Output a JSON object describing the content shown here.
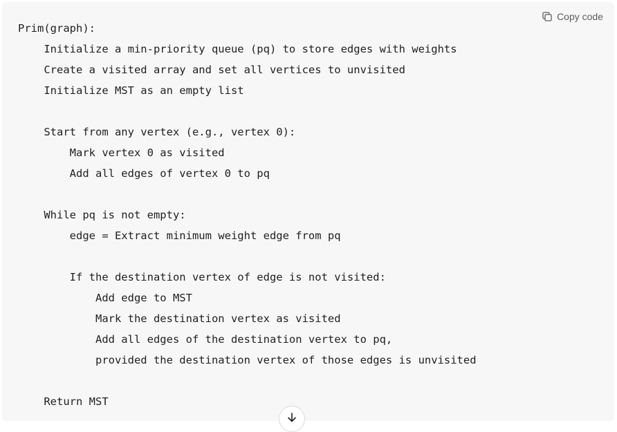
{
  "code_block": {
    "copy_label": "Copy code",
    "lines": [
      "Prim(graph):",
      "    Initialize a min-priority queue (pq) to store edges with weights",
      "    Create a visited array and set all vertices to unvisited",
      "    Initialize MST as an empty list",
      "",
      "    Start from any vertex (e.g., vertex 0):",
      "        Mark vertex 0 as visited",
      "        Add all edges of vertex 0 to pq",
      "",
      "    While pq is not empty:",
      "        edge = Extract minimum weight edge from pq",
      "",
      "        If the destination vertex of edge is not visited:",
      "            Add edge to MST",
      "            Mark the destination vertex as visited",
      "            Add all edges of the destination vertex to pq,",
      "            provided the destination vertex of those edges is unvisited",
      "",
      "    Return MST"
    ]
  },
  "icons": {
    "copy": "copy-icon",
    "scroll": "arrow-down-icon"
  }
}
